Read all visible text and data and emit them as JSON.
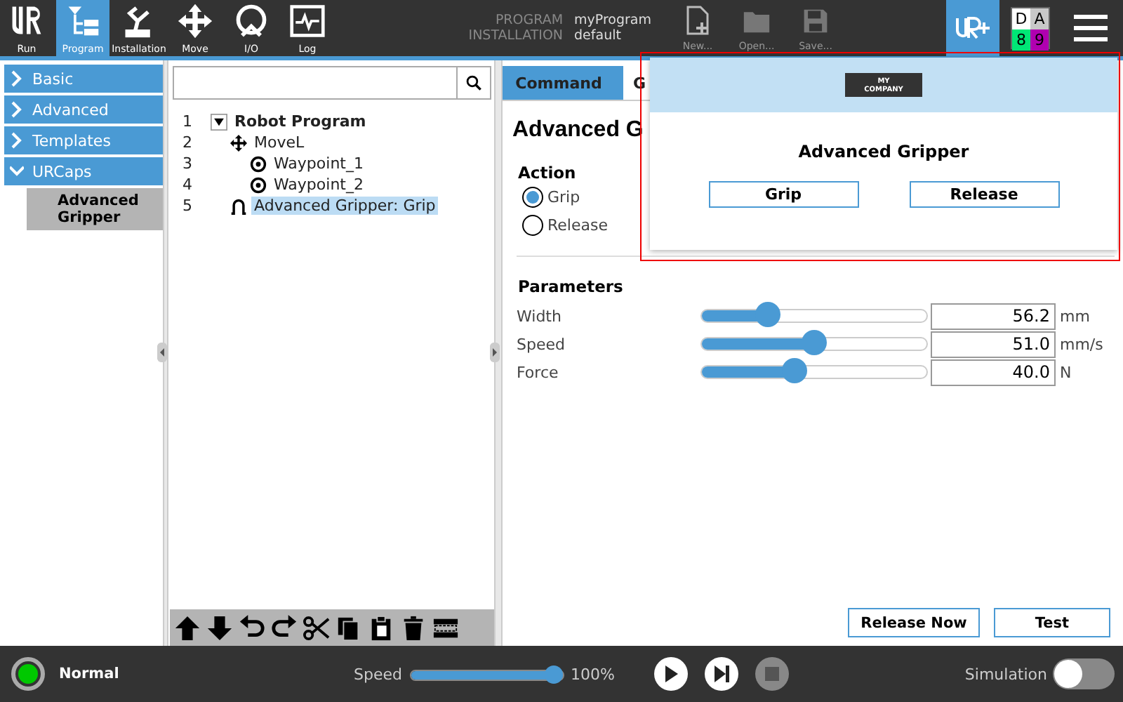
{
  "top_nav": [
    {
      "label": "Run",
      "selected": false
    },
    {
      "label": "Program",
      "selected": true
    },
    {
      "label": "Installation",
      "selected": false
    },
    {
      "label": "Move",
      "selected": false
    },
    {
      "label": "I/O",
      "selected": false
    },
    {
      "label": "Log",
      "selected": false
    }
  ],
  "file_info": [
    {
      "label": "PROGRAM",
      "value": "myProgram"
    },
    {
      "label": "INSTALLATION",
      "value": "default"
    }
  ],
  "file_buttons": [
    "New...",
    "Open...",
    "Save..."
  ],
  "indicators": [
    {
      "label": "D",
      "color": "#ffffff"
    },
    {
      "label": "A",
      "color": "#c8c8c8"
    },
    {
      "label": "8",
      "color": "#00e676"
    },
    {
      "label": "9",
      "color": "#b000b0"
    }
  ],
  "sidebar": [
    {
      "label": "Basic",
      "expanded": false
    },
    {
      "label": "Advanced",
      "expanded": false
    },
    {
      "label": "Templates",
      "expanded": false
    },
    {
      "label": "URCaps",
      "expanded": true,
      "children": [
        {
          "label": "Advanced Gripper",
          "selected": true
        }
      ]
    }
  ],
  "program_tree": [
    {
      "line": "1",
      "label": "Robot Program",
      "kind": "root",
      "expanded": true,
      "selected": false,
      "children": [
        {
          "line": "2",
          "label": "MoveL",
          "kind": "move",
          "selected": false,
          "children": [
            {
              "line": "3",
              "label": "Waypoint_1",
              "kind": "waypoint",
              "selected": false
            },
            {
              "line": "4",
              "label": "Waypoint_2",
              "kind": "waypoint",
              "selected": false
            }
          ]
        },
        {
          "line": "5",
          "label": "Advanced Gripper: Grip",
          "kind": "gripper",
          "selected": true
        }
      ]
    }
  ],
  "tabs": [
    {
      "label": "Command",
      "selected": true
    },
    {
      "label": "G",
      "selected": false
    }
  ],
  "node_title": "Advanced G",
  "action": {
    "title": "Action",
    "options": [
      {
        "label": "Grip",
        "selected": true
      },
      {
        "label": "Release",
        "selected": false
      }
    ]
  },
  "parameters": {
    "title": "Parameters",
    "rows": [
      {
        "name": "Width",
        "level": 0.27,
        "value": "56.2",
        "unit": "mm"
      },
      {
        "name": "Speed",
        "level": 0.5,
        "value": "51.0",
        "unit": "mm/s"
      },
      {
        "name": "Force",
        "level": 0.4,
        "value": "40.0",
        "unit": "N"
      }
    ]
  },
  "panel_buttons": [
    "Release Now",
    "Test"
  ],
  "popup": {
    "logo_lines": [
      "MY",
      "COMPANY"
    ],
    "title": "Advanced Gripper",
    "buttons": [
      "Grip",
      "Release"
    ]
  },
  "status_bar": {
    "mode": "Normal",
    "speed_label": "Speed",
    "speed": {
      "level": 1.0
    },
    "speed_reading": "100%",
    "controls": [
      {
        "kind": "play",
        "disabled": false
      },
      {
        "kind": "step",
        "disabled": false
      },
      {
        "kind": "stop",
        "disabled": true
      }
    ],
    "simulation": {
      "label": "Simulation",
      "on": false
    }
  }
}
